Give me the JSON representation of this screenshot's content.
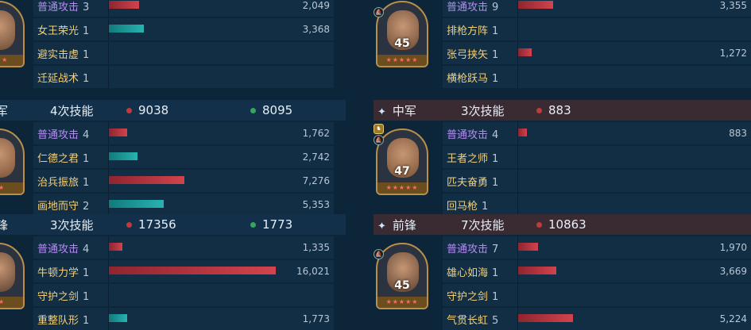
{
  "left": {
    "sections": [
      {
        "header": {
          "position": "",
          "count": "",
          "damage": "",
          "heal": ""
        },
        "portrait": {
          "level": "",
          "stars": "★★★"
        },
        "rows": [
          {
            "skill": "普通攻击",
            "times": "3",
            "type": "dmg",
            "value": "2,049",
            "fraction": 0.18
          },
          {
            "skill": "女王荣光",
            "times": "1",
            "type": "heal",
            "value": "3,368",
            "fraction": 0.21
          },
          {
            "skill": "避实击虚",
            "times": "1",
            "type": "none",
            "value": "",
            "fraction": 0
          },
          {
            "skill": "迁延战术",
            "times": "1",
            "type": "none",
            "value": "",
            "fraction": 0
          }
        ]
      },
      {
        "header": {
          "position": "军",
          "count": "4次技能",
          "damage": "9038",
          "heal": "8095"
        },
        "portrait": {
          "level": "",
          "stars": "★★"
        },
        "rows": [
          {
            "skill": "普通攻击",
            "times": "4",
            "type": "dmg",
            "value": "1,762",
            "fraction": 0.11
          },
          {
            "skill": "仁德之君",
            "times": "1",
            "type": "heal",
            "value": "2,742",
            "fraction": 0.17
          },
          {
            "skill": "治兵振旅",
            "times": "1",
            "type": "dmg",
            "value": "7,276",
            "fraction": 0.45
          },
          {
            "skill": "画地而守",
            "times": "2",
            "type": "heal",
            "value": "5,353",
            "fraction": 0.33
          }
        ]
      },
      {
        "header": {
          "position": "锋",
          "count": "3次技能",
          "damage": "17356",
          "heal": "1773"
        },
        "portrait": {
          "level": "",
          "stars": "★★"
        },
        "rows": [
          {
            "skill": "普通攻击",
            "times": "4",
            "type": "dmg",
            "value": "1,335",
            "fraction": 0.08
          },
          {
            "skill": "牛顿力学",
            "times": "1",
            "type": "dmg",
            "value": "16,021",
            "fraction": 1.0
          },
          {
            "skill": "守护之剑",
            "times": "1",
            "type": "none",
            "value": "",
            "fraction": 0
          },
          {
            "skill": "重整队形",
            "times": "1",
            "type": "heal",
            "value": "1,773",
            "fraction": 0.11
          }
        ]
      }
    ]
  },
  "right": {
    "sections": [
      {
        "header": {
          "position": "",
          "count": "",
          "damage": ""
        },
        "portrait": {
          "level": "45",
          "stars": "★★★★★"
        },
        "rows": [
          {
            "skill": "普通攻击",
            "times": "9",
            "type": "dmg",
            "value": "3,355",
            "fraction": 0.21
          },
          {
            "skill": "排枪方阵",
            "times": "1",
            "type": "none",
            "value": "",
            "fraction": 0
          },
          {
            "skill": "张弓挟矢",
            "times": "1",
            "type": "dmg",
            "value": "1,272",
            "fraction": 0.08
          },
          {
            "skill": "横枪跃马",
            "times": "1",
            "type": "none",
            "value": "",
            "fraction": 0
          }
        ]
      },
      {
        "header": {
          "position": "中军",
          "count": "3次技能",
          "damage": "883"
        },
        "portrait": {
          "level": "47",
          "stars": "★★★★★"
        },
        "rows": [
          {
            "skill": "普通攻击",
            "times": "4",
            "type": "dmg",
            "value": "883",
            "fraction": 0.05
          },
          {
            "skill": "王者之师",
            "times": "1",
            "type": "none",
            "value": "",
            "fraction": 0
          },
          {
            "skill": "匹夫奋勇",
            "times": "1",
            "type": "none",
            "value": "",
            "fraction": 0
          },
          {
            "skill": "回马枪",
            "times": "1",
            "type": "none",
            "value": "",
            "fraction": 0
          }
        ]
      },
      {
        "header": {
          "position": "前锋",
          "count": "7次技能",
          "damage": "10863"
        },
        "portrait": {
          "level": "45",
          "stars": "★★★★★"
        },
        "rows": [
          {
            "skill": "普通攻击",
            "times": "7",
            "type": "dmg",
            "value": "1,970",
            "fraction": 0.12
          },
          {
            "skill": "雄心如海",
            "times": "1",
            "type": "dmg",
            "value": "3,669",
            "fraction": 0.23
          },
          {
            "skill": "守护之剑",
            "times": "1",
            "type": "none",
            "value": "",
            "fraction": 0
          },
          {
            "skill": "气贯长虹",
            "times": "5",
            "type": "dmg",
            "value": "5,224",
            "fraction": 0.33
          }
        ]
      }
    ]
  },
  "colors": {
    "damage": "#c0393c",
    "heal": "#1e9c9a",
    "skill_purple": "#b48cf0",
    "skill_gold": "#f2cf7b"
  }
}
